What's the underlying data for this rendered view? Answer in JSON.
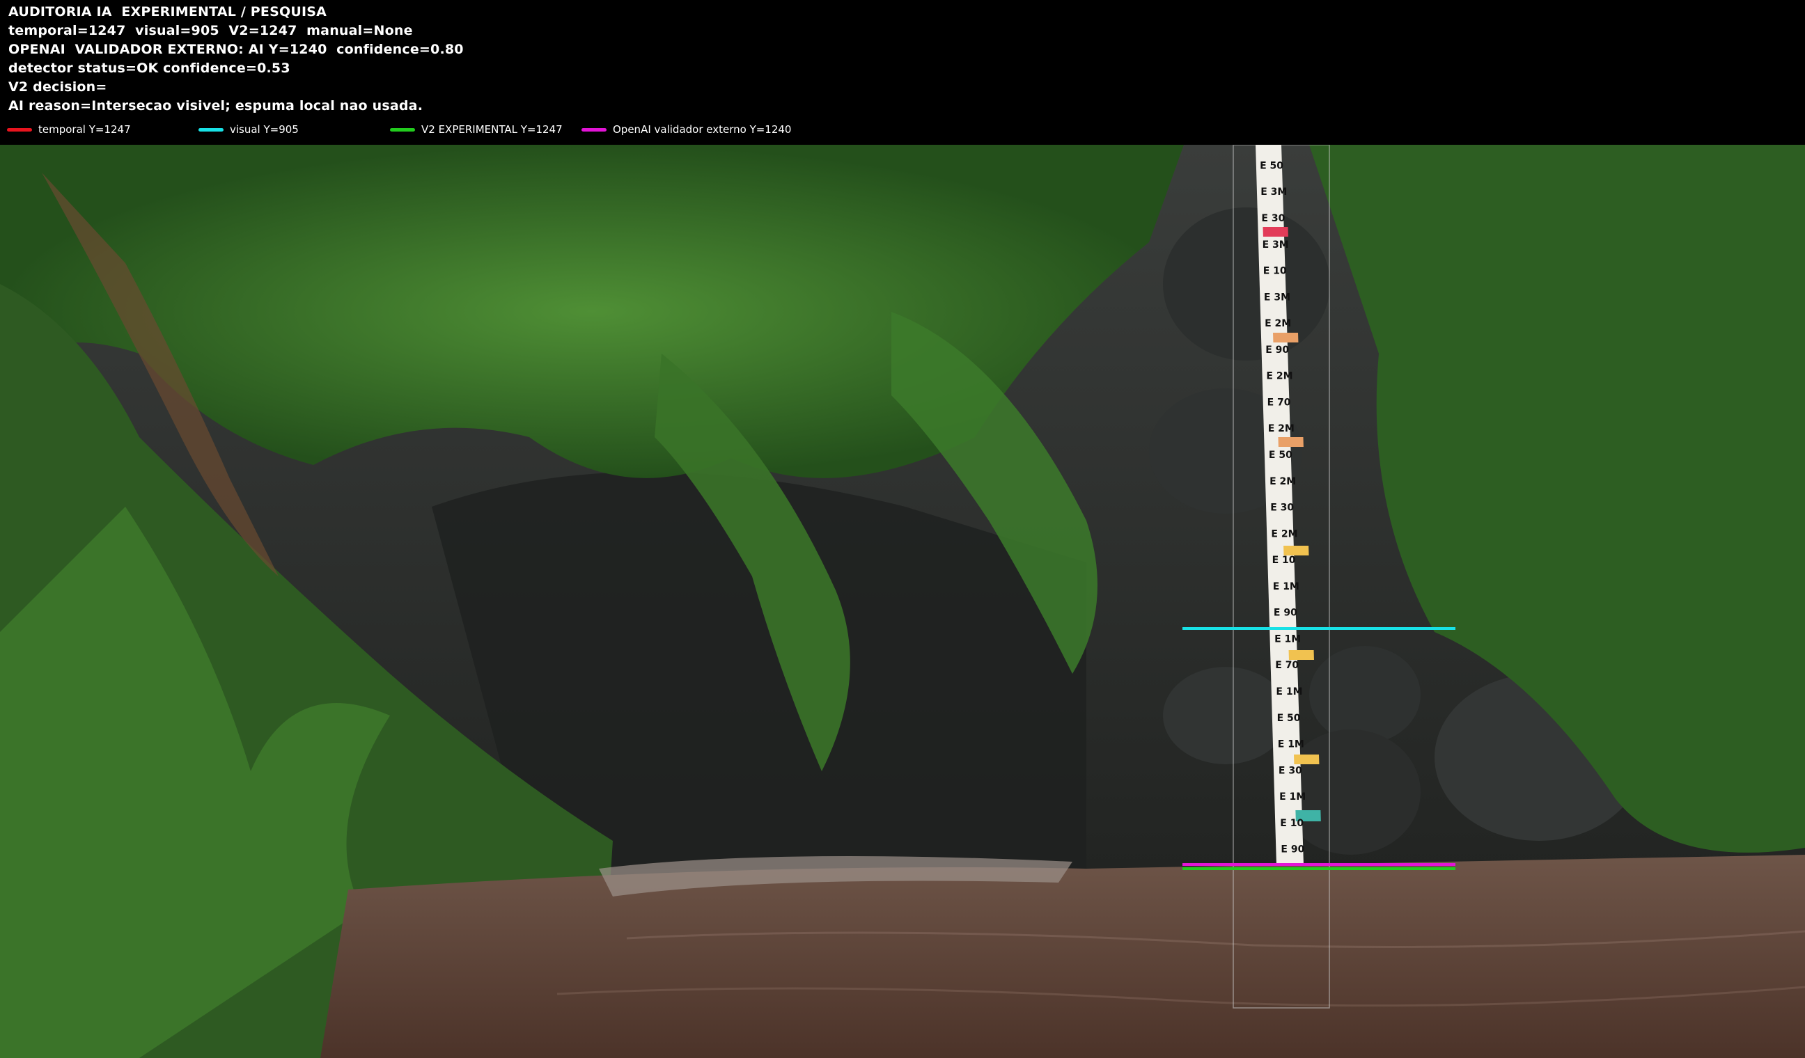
{
  "header": {
    "line1": "AUDITORIA IA  EXPERIMENTAL / PESQUISA",
    "line2": "temporal=1247  visual=905  V2=1247  manual=None",
    "line3": "OPENAI  VALIDADOR EXTERNO: AI Y=1240  confidence=0.80",
    "line4": "detector status=OK confidence=0.53",
    "line5": "V2 decision=",
    "line6": "AI reason=Intersecao visivel; espuma local nao usada."
  },
  "legend": [
    {
      "label": "temporal Y=1247",
      "color": "#e8141e"
    },
    {
      "label": "visual Y=905",
      "color": "#18e1e6"
    },
    {
      "label": "V2 EXPERIMENTAL Y=1247",
      "color": "#22cc1e"
    },
    {
      "label": "OpenAI validador externo Y=1240",
      "color": "#e214d6"
    }
  ],
  "colors": {
    "temporal": "#e8141e",
    "visual": "#18e1e6",
    "v2": "#22cc1e",
    "openai": "#e214d6",
    "header_bg": "#000000",
    "water": "#5a4034",
    "foliage": "#2f6a22"
  },
  "gauge_marks": [
    "50",
    "3M",
    "30",
    "3M",
    "10",
    "3M",
    "2M",
    "90",
    "2M",
    "70",
    "2M",
    "50",
    "2M",
    "30",
    "2M",
    "10",
    "1M",
    "90",
    "1M",
    "70",
    "1M",
    "50",
    "1M",
    "30",
    "1M",
    "10",
    "90"
  ]
}
